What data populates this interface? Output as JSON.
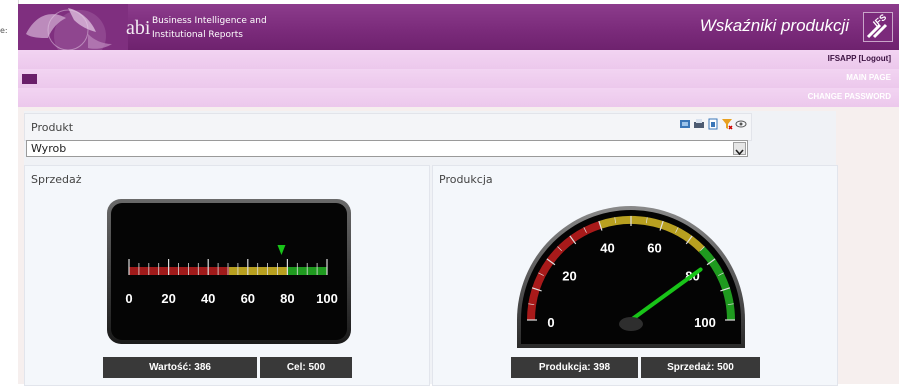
{
  "left_strip": {
    "text": "e:"
  },
  "header": {
    "brand_line1": "Business Intelligence and",
    "brand_line2": "Institutional Reports",
    "title": "Wskaźniki produkcji",
    "brand_color": "#7a2a7a"
  },
  "nav": {
    "logout": "IFSAPP [Logout]",
    "main_page": "MAIN PAGE",
    "change_password": "CHANGE PASSWORD"
  },
  "produkt": {
    "label": "Produkt",
    "selected": "Wyrob",
    "toolbar_icons": [
      "refresh-icon",
      "print-icon",
      "export-icon",
      "filter-icon",
      "view-icon"
    ]
  },
  "sprzedaz_panel": {
    "title": "Sprzedaż",
    "scale": [
      "0",
      "20",
      "40",
      "60",
      "80",
      "100"
    ],
    "marker_value": 77,
    "value_label": "Wartość: 386",
    "target_label": "Cel: 500"
  },
  "produkcja_panel": {
    "title": "Produkcja",
    "scale": [
      "0",
      "20",
      "40",
      "60",
      "80",
      "100"
    ],
    "needle_value": 80,
    "value_label": "Produkcja: 398",
    "target_label": "Sprzedaż: 500"
  }
}
